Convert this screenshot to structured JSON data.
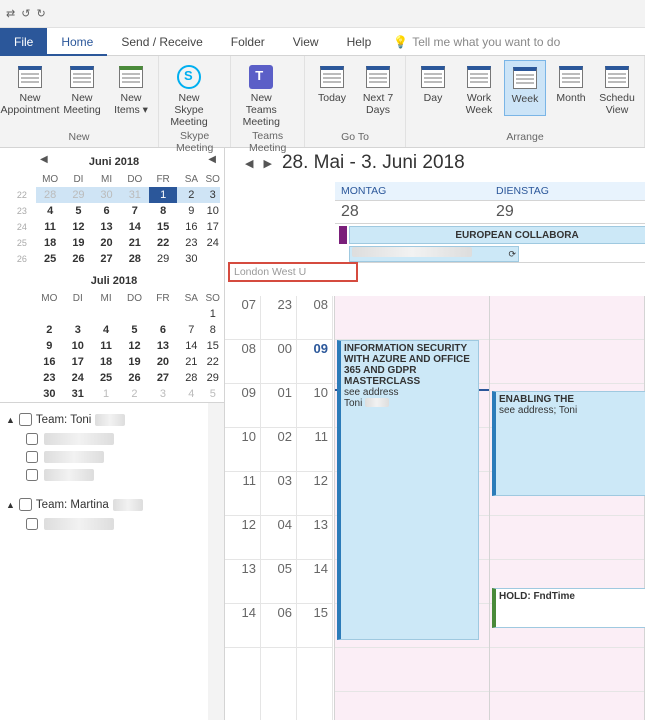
{
  "qat": {
    "undo": "↺",
    "redo": "↻"
  },
  "tabs": {
    "file": "File",
    "home": "Home",
    "sendreceive": "Send / Receive",
    "folder": "Folder",
    "view": "View",
    "help": "Help",
    "tellme": "Tell me what you want to do"
  },
  "ribbon": {
    "new_appt": "New\nAppointment",
    "new_meeting": "New\nMeeting",
    "new_items": "New\nItems ▾",
    "grp_new": "New",
    "skype": "New Skype\nMeeting",
    "grp_skype": "Skype Meeting",
    "teams": "New Teams\nMeeting",
    "grp_teams": "Teams Meeting",
    "today": "Today",
    "next7": "Next 7\nDays",
    "grp_goto": "Go To",
    "day": "Day",
    "workweek": "Work\nWeek",
    "week": "Week",
    "month": "Month",
    "schedule": "Schedu\nView",
    "grp_arrange": "Arrange"
  },
  "minical1": {
    "title": "Juni 2018",
    "dow": [
      "MO",
      "DI",
      "MI",
      "DO",
      "FR",
      "SA",
      "SO"
    ],
    "weeks": [
      {
        "wk": "22",
        "d": [
          "28",
          "29",
          "30",
          "31",
          "1",
          "2",
          "3"
        ],
        "other": [
          0,
          1,
          2,
          3
        ],
        "sel": 4,
        "hl": true
      },
      {
        "wk": "23",
        "d": [
          "4",
          "5",
          "6",
          "7",
          "8",
          "9",
          "10"
        ],
        "bold": [
          0,
          1,
          2,
          3,
          4
        ]
      },
      {
        "wk": "24",
        "d": [
          "11",
          "12",
          "13",
          "14",
          "15",
          "16",
          "17"
        ],
        "bold": [
          0,
          1,
          2,
          3,
          4
        ]
      },
      {
        "wk": "25",
        "d": [
          "18",
          "19",
          "20",
          "21",
          "22",
          "23",
          "24"
        ],
        "bold": [
          0,
          1,
          2,
          3,
          4
        ]
      },
      {
        "wk": "26",
        "d": [
          "25",
          "26",
          "27",
          "28",
          "29",
          "30",
          ""
        ],
        "bold": [
          0,
          1,
          2,
          3
        ]
      }
    ]
  },
  "minical2": {
    "title": "Juli 2018",
    "dow": [
      "MO",
      "DI",
      "MI",
      "DO",
      "FR",
      "SA",
      "SO"
    ],
    "weeks": [
      {
        "wk": "",
        "d": [
          "",
          "",
          "",
          "",
          "",
          "",
          "1"
        ]
      },
      {
        "wk": "",
        "d": [
          "2",
          "3",
          "4",
          "5",
          "6",
          "7",
          "8"
        ],
        "bold": [
          0,
          1,
          2,
          3,
          4
        ]
      },
      {
        "wk": "",
        "d": [
          "9",
          "10",
          "11",
          "12",
          "13",
          "14",
          "15"
        ],
        "bold": [
          0,
          1,
          2,
          3,
          4
        ]
      },
      {
        "wk": "",
        "d": [
          "16",
          "17",
          "18",
          "19",
          "20",
          "21",
          "22"
        ],
        "bold": [
          0,
          1,
          2,
          3,
          4
        ]
      },
      {
        "wk": "",
        "d": [
          "23",
          "24",
          "25",
          "26",
          "27",
          "28",
          "29"
        ],
        "bold": [
          0,
          1,
          2,
          3,
          4
        ]
      },
      {
        "wk": "",
        "d": [
          "30",
          "31",
          "1",
          "2",
          "3",
          "4",
          "5"
        ],
        "other": [
          2,
          3,
          4,
          5,
          6
        ],
        "bold": [
          0,
          1
        ]
      }
    ]
  },
  "teams": {
    "t1": "Team: Toni",
    "t2": "Team: Martina"
  },
  "cal": {
    "range": "28. Mai - 3. Juni 2018",
    "day1": "MONTAG",
    "day2": "DIENSTAG",
    "num1": "28",
    "num2": "29",
    "allday_evt": "EUROPEAN COLLABORA",
    "tz_label": "London West U",
    "tc1": [
      "07",
      "08",
      "09",
      "10",
      "11",
      "12",
      "13",
      "14"
    ],
    "tc2": [
      "23",
      "00",
      "01",
      "02",
      "03",
      "04",
      "05",
      "06"
    ],
    "tc3": [
      "08",
      "09",
      "10",
      "11",
      "12",
      "13",
      "14",
      "15"
    ],
    "evt1_title": "INFORMATION SECURITY WITH AZURE AND OFFICE 365 AND GDPR MASTERCLASS",
    "evt1_loc": "see address",
    "evt1_org": "Toni",
    "evt2_title": "ENABLING THE",
    "evt2_loc": "see address; Toni",
    "evt3_title": "HOLD: FndTime"
  }
}
